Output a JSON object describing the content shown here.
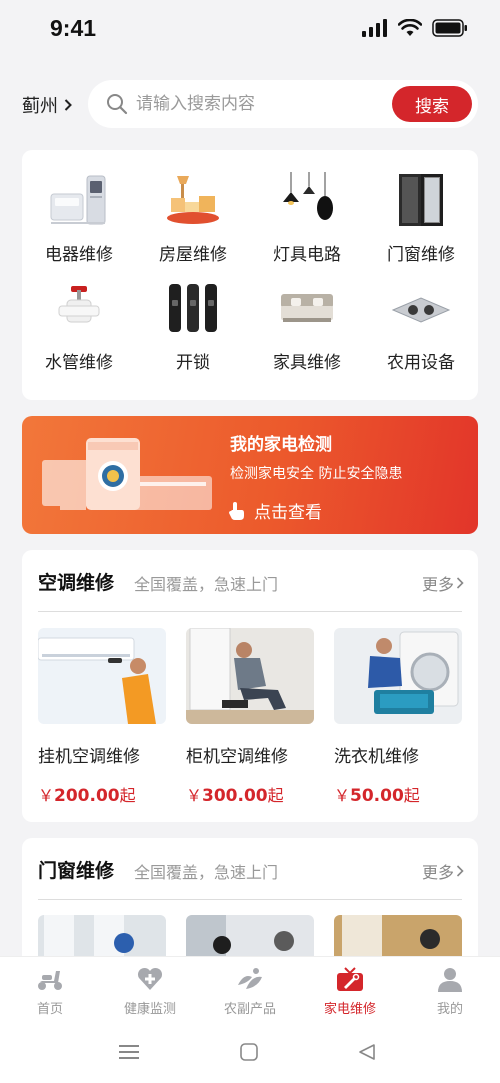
{
  "status": {
    "time": "9:41"
  },
  "header": {
    "city": "蓟州",
    "search_placeholder": "请输入搜索内容",
    "search_button": "搜索"
  },
  "categories": [
    {
      "label": "电器维修",
      "icon": "appliance-icon"
    },
    {
      "label": "房屋维修",
      "icon": "house-repair-icon"
    },
    {
      "label": "灯具电路",
      "icon": "lamp-icon"
    },
    {
      "label": "门窗维修",
      "icon": "door-window-icon"
    },
    {
      "label": "水管维修",
      "icon": "water-pipe-icon"
    },
    {
      "label": "开锁",
      "icon": "lock-icon"
    },
    {
      "label": "家具维修",
      "icon": "furniture-icon"
    },
    {
      "label": "农用设备",
      "icon": "farm-equipment-icon"
    }
  ],
  "banner": {
    "title": "我的家电检测",
    "subtitle": "检测家电安全 防止安全隐患",
    "cta": "点击查看"
  },
  "sections": [
    {
      "title": "空调维修",
      "subtitle": "全国覆盖，急速上门",
      "more": "更多",
      "items": [
        {
          "name": "挂机空调维修",
          "currency": "￥",
          "price": "200.00",
          "suffix": "起"
        },
        {
          "name": "柜机空调维修",
          "currency": "￥",
          "price": "300.00",
          "suffix": "起"
        },
        {
          "name": "洗衣机维修",
          "currency": "￥",
          "price": "50.00",
          "suffix": "起"
        }
      ]
    },
    {
      "title": "门窗维修",
      "subtitle": "全国覆盖，急速上门",
      "more": "更多"
    }
  ],
  "tabs": [
    {
      "label": "首页",
      "icon": "scooter-icon",
      "active": false
    },
    {
      "label": "健康监测",
      "icon": "heart-plus-icon",
      "active": false
    },
    {
      "label": "农副产品",
      "icon": "produce-icon",
      "active": false
    },
    {
      "label": "家电维修",
      "icon": "tv-repair-icon",
      "active": true
    },
    {
      "label": "我的",
      "icon": "user-icon",
      "active": false
    }
  ],
  "colors": {
    "accent": "#d4262b",
    "banner_start": "#f2773a",
    "banner_end": "#e2352a"
  }
}
